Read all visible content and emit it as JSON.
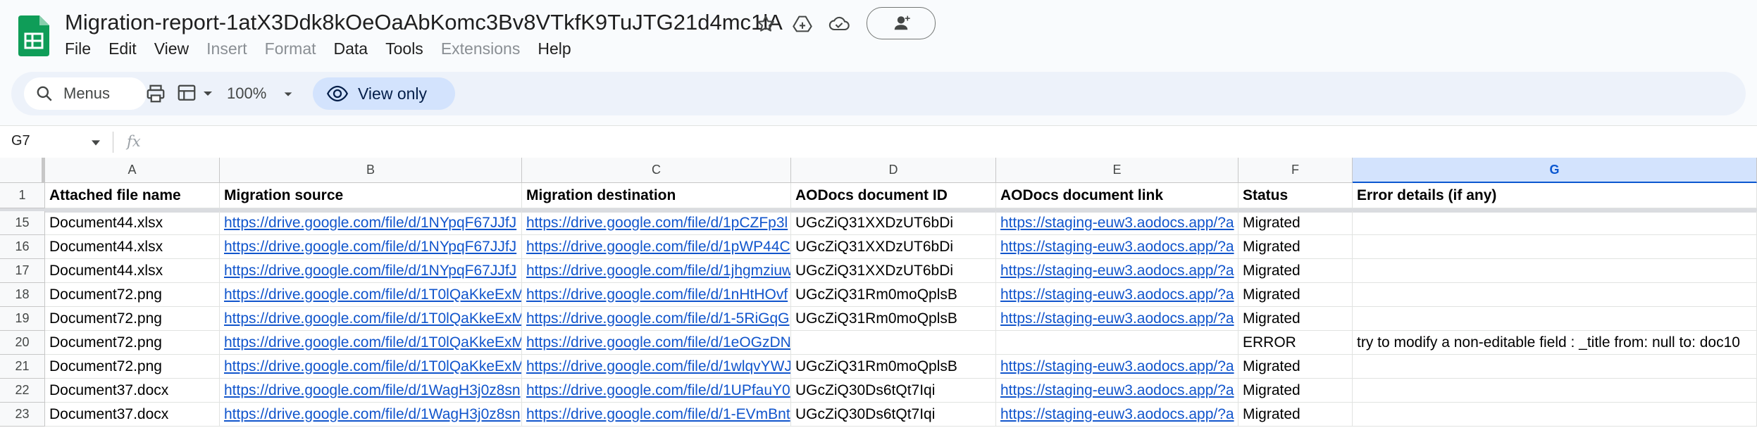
{
  "app": {
    "doc_title": "Migration-report-1atX3Ddk8kOeOaAbKomc3Bv8VTkfK9TuJTG21d4mc1lA",
    "menus": [
      {
        "label": "File",
        "enabled": true
      },
      {
        "label": "Edit",
        "enabled": true
      },
      {
        "label": "View",
        "enabled": true
      },
      {
        "label": "Insert",
        "enabled": false
      },
      {
        "label": "Format",
        "enabled": false
      },
      {
        "label": "Data",
        "enabled": true
      },
      {
        "label": "Tools",
        "enabled": true
      },
      {
        "label": "Extensions",
        "enabled": false
      },
      {
        "label": "Help",
        "enabled": true
      }
    ]
  },
  "toolbar": {
    "search_label": "Menus",
    "zoom": "100%",
    "view_only_label": "View only"
  },
  "formula_bar": {
    "name_box": "G7",
    "fx_label": "fx"
  },
  "sheet": {
    "columns": [
      "A",
      "B",
      "C",
      "D",
      "E",
      "F",
      "G"
    ],
    "selected_column": "G",
    "header_row": {
      "num": "1",
      "cells": [
        "Attached file name",
        "Migration source",
        "Migration destination",
        "AODocs document ID",
        "AODocs document link",
        "Status",
        "Error details (if any)"
      ]
    },
    "rows": [
      {
        "num": "15",
        "cells": [
          "Document44.xlsx",
          "https://drive.google.com/file/d/1NYpqF67JJfJ",
          "https://drive.google.com/file/d/1pCZFp3l",
          "UGcZiQ31XXDzUT6bDi",
          "https://staging-euw3.aodocs.app/?a",
          "Migrated",
          ""
        ]
      },
      {
        "num": "16",
        "cells": [
          "Document44.xlsx",
          "https://drive.google.com/file/d/1NYpqF67JJfJ",
          "https://drive.google.com/file/d/1pWP44C",
          "UGcZiQ31XXDzUT6bDi",
          "https://staging-euw3.aodocs.app/?a",
          "Migrated",
          ""
        ]
      },
      {
        "num": "17",
        "cells": [
          "Document44.xlsx",
          "https://drive.google.com/file/d/1NYpqF67JJfJ",
          "https://drive.google.com/file/d/1jhgmziuw",
          "UGcZiQ31XXDzUT6bDi",
          "https://staging-euw3.aodocs.app/?a",
          "Migrated",
          ""
        ]
      },
      {
        "num": "18",
        "cells": [
          "Document72.png",
          "https://drive.google.com/file/d/1T0lQaKkeExM",
          "https://drive.google.com/file/d/1nHtHOvf",
          "UGcZiQ31Rm0moQplsB",
          "https://staging-euw3.aodocs.app/?a",
          "Migrated",
          ""
        ]
      },
      {
        "num": "19",
        "cells": [
          "Document72.png",
          "https://drive.google.com/file/d/1T0lQaKkeExM",
          "https://drive.google.com/file/d/1-5RiGqG",
          "UGcZiQ31Rm0moQplsB",
          "https://staging-euw3.aodocs.app/?a",
          "Migrated",
          ""
        ]
      },
      {
        "num": "20",
        "cells": [
          "Document72.png",
          "https://drive.google.com/file/d/1T0lQaKkeExM",
          "https://drive.google.com/file/d/1eOGzDN",
          "",
          "",
          "ERROR",
          "try to modify a non-editable field : _title from: null to: doc10"
        ]
      },
      {
        "num": "21",
        "cells": [
          "Document72.png",
          "https://drive.google.com/file/d/1T0lQaKkeExM",
          "https://drive.google.com/file/d/1wlqvYWJ",
          "UGcZiQ31Rm0moQplsB",
          "https://staging-euw3.aodocs.app/?a",
          "Migrated",
          ""
        ]
      },
      {
        "num": "22",
        "cells": [
          "Document37.docx",
          "https://drive.google.com/file/d/1WagH3j0z8sn",
          "https://drive.google.com/file/d/1UPfauY0",
          "UGcZiQ30Ds6tQt7Iqi",
          "https://staging-euw3.aodocs.app/?a",
          "Migrated",
          ""
        ]
      },
      {
        "num": "23",
        "cells": [
          "Document37.docx",
          "https://drive.google.com/file/d/1WagH3j0z8sn",
          "https://drive.google.com/file/d/1-EVmBnt",
          "UGcZiQ30Ds6tQt7Iqi",
          "https://staging-euw3.aodocs.app/?a",
          "Migrated",
          ""
        ]
      }
    ]
  }
}
